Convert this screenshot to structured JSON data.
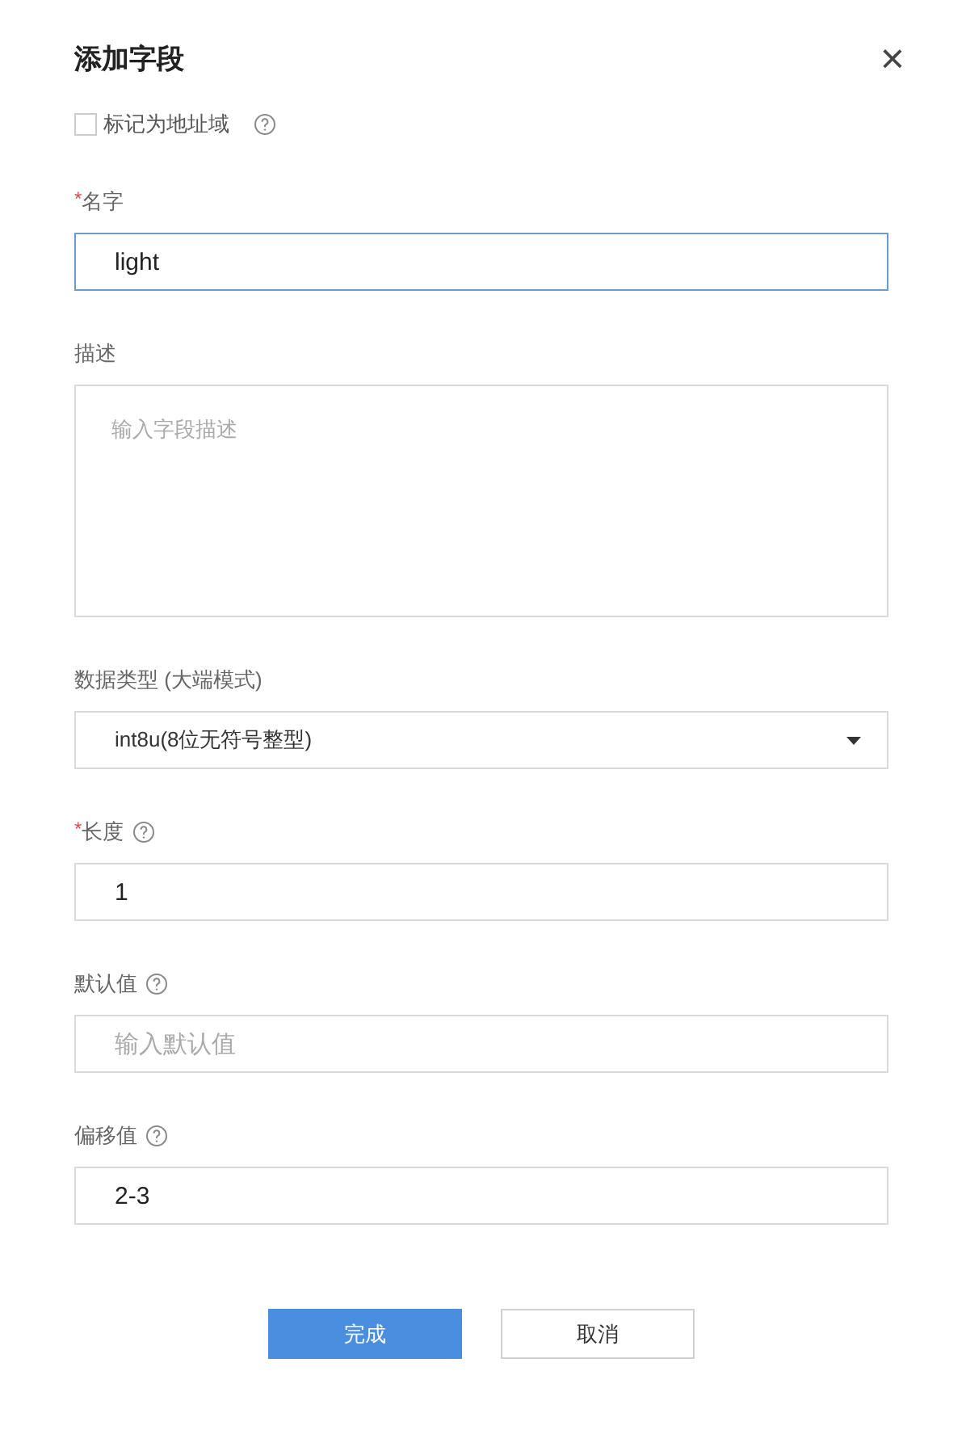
{
  "dialog": {
    "title": "添加字段",
    "close_icon": "×"
  },
  "address_checkbox": {
    "label": "标记为地址域",
    "checked": false,
    "help": true
  },
  "fields": [
    {
      "kind": "input",
      "required_mark": "*",
      "label": "名字",
      "help": false,
      "value": "light",
      "focused": true
    },
    {
      "kind": "textarea",
      "label": "描述",
      "help": false,
      "placeholder": "输入字段描述",
      "focused": false
    },
    {
      "kind": "select",
      "label": "数据类型 (大端模式)",
      "help": false,
      "value": "int8u(8位无符号整型)",
      "focused": false
    },
    {
      "kind": "input",
      "required_mark": "*",
      "label": "长度",
      "help": true,
      "value": "1",
      "focused": false
    },
    {
      "kind": "input",
      "label": "默认值",
      "help": true,
      "placeholder": "输入默认值",
      "focused": false
    },
    {
      "kind": "input",
      "label": "偏移值",
      "help": true,
      "value": "2-3",
      "focused": false
    }
  ],
  "buttons": [
    {
      "label": "完成",
      "kind": "primary"
    },
    {
      "label": "取消",
      "kind": "secondary"
    }
  ]
}
